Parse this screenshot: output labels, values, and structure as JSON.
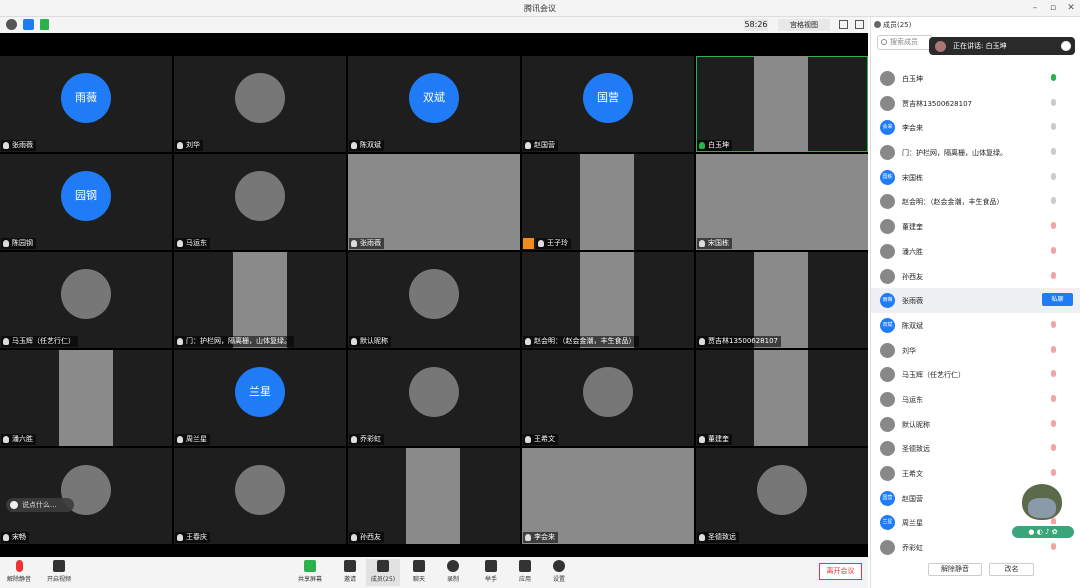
{
  "title": "腾讯会议",
  "toolbar": {
    "timer": "58:26",
    "view_label": "宫格视图"
  },
  "tiles": [
    {
      "name": "张雨薇",
      "avatar_text": "雨薇"
    },
    {
      "name": "刘华",
      "avatar_text": ""
    },
    {
      "name": "陈双斌",
      "avatar_text": "双斌"
    },
    {
      "name": "赵国营",
      "avatar_text": "国营"
    },
    {
      "name": "白玉坤",
      "avatar_text": ""
    },
    {
      "name": "陈园钢",
      "avatar_text": "园钢"
    },
    {
      "name": "马运东",
      "avatar_text": ""
    },
    {
      "name": "张雨薇",
      "avatar_text": ""
    },
    {
      "name": "王子玲",
      "avatar_text": ""
    },
    {
      "name": "宋国栋",
      "avatar_text": ""
    },
    {
      "name": "马玉辉（任艺行仁）",
      "avatar_text": ""
    },
    {
      "name": "门：护栏网，隔离栅，山体复绿。",
      "avatar_text": ""
    },
    {
      "name": "默认昵称",
      "avatar_text": ""
    },
    {
      "name": "赵会明：（赵会金潮，丰生食品）",
      "avatar_text": ""
    },
    {
      "name": "贾吉林13500628107",
      "avatar_text": ""
    },
    {
      "name": "潘六胜",
      "avatar_text": ""
    },
    {
      "name": "周兰星",
      "avatar_text": "兰星"
    },
    {
      "name": "乔彩虹",
      "avatar_text": ""
    },
    {
      "name": "王希文",
      "avatar_text": ""
    },
    {
      "name": "董建奎",
      "avatar_text": ""
    },
    {
      "name": "宋畅",
      "avatar_text": ""
    },
    {
      "name": "王春庆",
      "avatar_text": ""
    },
    {
      "name": "孙西友",
      "avatar_text": ""
    },
    {
      "name": "李会来",
      "avatar_text": ""
    },
    {
      "name": "圣德致远",
      "avatar_text": ""
    }
  ],
  "chat_placeholder": "说点什么...",
  "bottom": {
    "mute": "解除静音",
    "video": "开启视频",
    "share": "共享屏幕",
    "invite": "邀请",
    "members": "成员(25)",
    "chat": "聊天",
    "record": "录制",
    "raise": "举手",
    "apps": "应用",
    "settings": "设置",
    "leave": "离开会议"
  },
  "panel": {
    "header": "成员(25)",
    "search_placeholder": "搜索成员",
    "speaking": "正在讲话: 白玉坤",
    "private_chat": "私聊",
    "mute_all": "解除静音",
    "rename": "改名",
    "members": [
      {
        "name": "白玉坤",
        "avatar": "",
        "mic": "on"
      },
      {
        "name": "贾吉林13500628107",
        "avatar": "",
        "mic": "idle"
      },
      {
        "name": "李会来",
        "avatar": "会来",
        "mic": "idle"
      },
      {
        "name": "门：护栏网，隔离栅，山体复绿。",
        "avatar": "",
        "mic": "idle"
      },
      {
        "name": "宋国栋",
        "avatar": "国栋",
        "mic": "idle"
      },
      {
        "name": "赵会明：（赵会金潮，丰生食品）",
        "avatar": "",
        "mic": "idle"
      },
      {
        "name": "董建奎",
        "avatar": "",
        "mic": "off"
      },
      {
        "name": "潘六胜",
        "avatar": "",
        "mic": "off"
      },
      {
        "name": "孙西友",
        "avatar": "",
        "mic": "off"
      },
      {
        "name": "张雨薇",
        "avatar": "雨薇",
        "mic": "idle"
      },
      {
        "name": "陈双斌",
        "avatar": "双斌",
        "mic": "off"
      },
      {
        "name": "刘华",
        "avatar": "",
        "mic": "off"
      },
      {
        "name": "马玉辉（任艺行仁）",
        "avatar": "",
        "mic": "off"
      },
      {
        "name": "马运东",
        "avatar": "",
        "mic": "off"
      },
      {
        "name": "默认昵称",
        "avatar": "",
        "mic": "off"
      },
      {
        "name": "圣德致远",
        "avatar": "",
        "mic": "off"
      },
      {
        "name": "王希文",
        "avatar": "",
        "mic": "off"
      },
      {
        "name": "赵国营",
        "avatar": "国营",
        "mic": "off"
      },
      {
        "name": "周兰星",
        "avatar": "兰星",
        "mic": "off"
      },
      {
        "name": "乔彩虹",
        "avatar": "",
        "mic": "off"
      }
    ]
  },
  "colors": {
    "accent": "#1f7cf6",
    "active": "#2bb24c",
    "danger": "#e33333"
  }
}
